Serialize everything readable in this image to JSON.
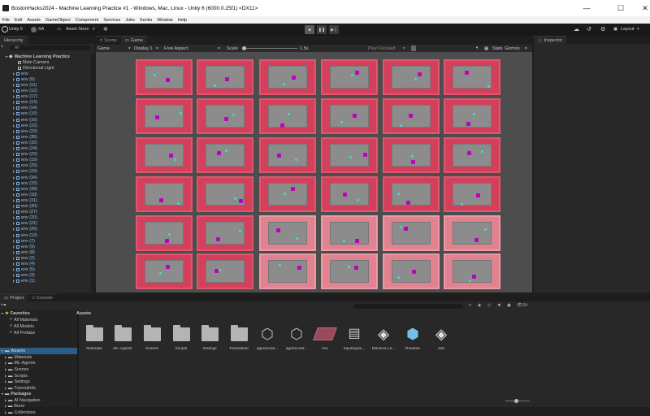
{
  "window": {
    "title": "BostonHacks2024 - Machine Learning Practice #1 - Windows, Mac, Linux - Unity 6 (6000.0.25f1) <DX11>",
    "minimize": "—",
    "maximize": "☐",
    "close": "✕"
  },
  "menu": [
    "File",
    "Edit",
    "Assets",
    "GameObject",
    "Component",
    "Services",
    "Jobs",
    "Sentis",
    "Window",
    "Help"
  ],
  "toolbar": {
    "unity_label": "Unity 6",
    "account": "SA",
    "asset_store": "Asset Store",
    "layout": "Layout"
  },
  "hierarchy": {
    "tab": "Hierarchy",
    "search_placeholder": "All",
    "scene": "Machine Learning Practice",
    "items": [
      "Main Camera",
      "Directional Light",
      "env",
      "env (6)",
      "env (11)",
      "env (12)",
      "env (17)",
      "env (13)",
      "env (14)",
      "env (15)",
      "env (16)",
      "env (22)",
      "env (23)",
      "env (35)",
      "env (32)",
      "env (24)",
      "env (22)",
      "env (19)",
      "env (25)",
      "env (29)",
      "env (34)",
      "env (33)",
      "env (28)",
      "env (18)",
      "env (31)",
      "env (30)",
      "env (27)",
      "env (20)",
      "env (21)",
      "env (26)",
      "env (10)",
      "env (7)",
      "env (9)",
      "env (8)",
      "env (2)",
      "env (4)",
      "env (5)",
      "env (3)",
      "env (1)"
    ]
  },
  "scene_tabs": {
    "scene": "Scene",
    "game": "Game"
  },
  "game_toolbar": {
    "mode": "Game",
    "display": "Display 1",
    "aspect": "Free Aspect",
    "scale_label": "Scale",
    "scale_value": "1.5x",
    "play_focused": "Play Focused",
    "stats": "Stats",
    "gizmos": "Gizmos"
  },
  "inspector": {
    "tab": "Inspector"
  },
  "project": {
    "tab_project": "Project",
    "tab_console": "Console",
    "count": "24",
    "favorites_header": "Favorites",
    "favorites": [
      "All Materials",
      "All Models",
      "All Prefabs"
    ],
    "assets_header": "Assets",
    "asset_folders": [
      "Materials",
      "ML-Agents",
      "Scenes",
      "Scripts",
      "Settings",
      "TutorialInfo"
    ],
    "packages_header": "Packages",
    "packages": [
      "AI Navigation",
      "Burst",
      "Collections"
    ],
    "breadcrumb": "Assets",
    "grid": [
      {
        "label": "Materials",
        "kind": "folder"
      },
      {
        "label": "ML-Agents",
        "kind": "folder"
      },
      {
        "label": "Scenes",
        "kind": "folder"
      },
      {
        "label": "Scripts",
        "kind": "folder"
      },
      {
        "label": "Settings",
        "kind": "folder"
      },
      {
        "label": "TutorialInfo",
        "kind": "folder"
      },
      {
        "label": "agentcontr...",
        "kind": "graph"
      },
      {
        "label": "agentcontr...",
        "kind": "graph"
      },
      {
        "label": "env",
        "kind": "prefab"
      },
      {
        "label": "InputSyste...",
        "kind": "input"
      },
      {
        "label": "Machine Le...",
        "kind": "unity"
      },
      {
        "label": "Readme",
        "kind": "readme"
      },
      {
        "label": "test",
        "kind": "unity"
      }
    ]
  },
  "colors": {
    "env_border": "#d4405c",
    "agent": "#c000c0",
    "target": "#3ce0c8",
    "floor": "#8c8c8c"
  }
}
